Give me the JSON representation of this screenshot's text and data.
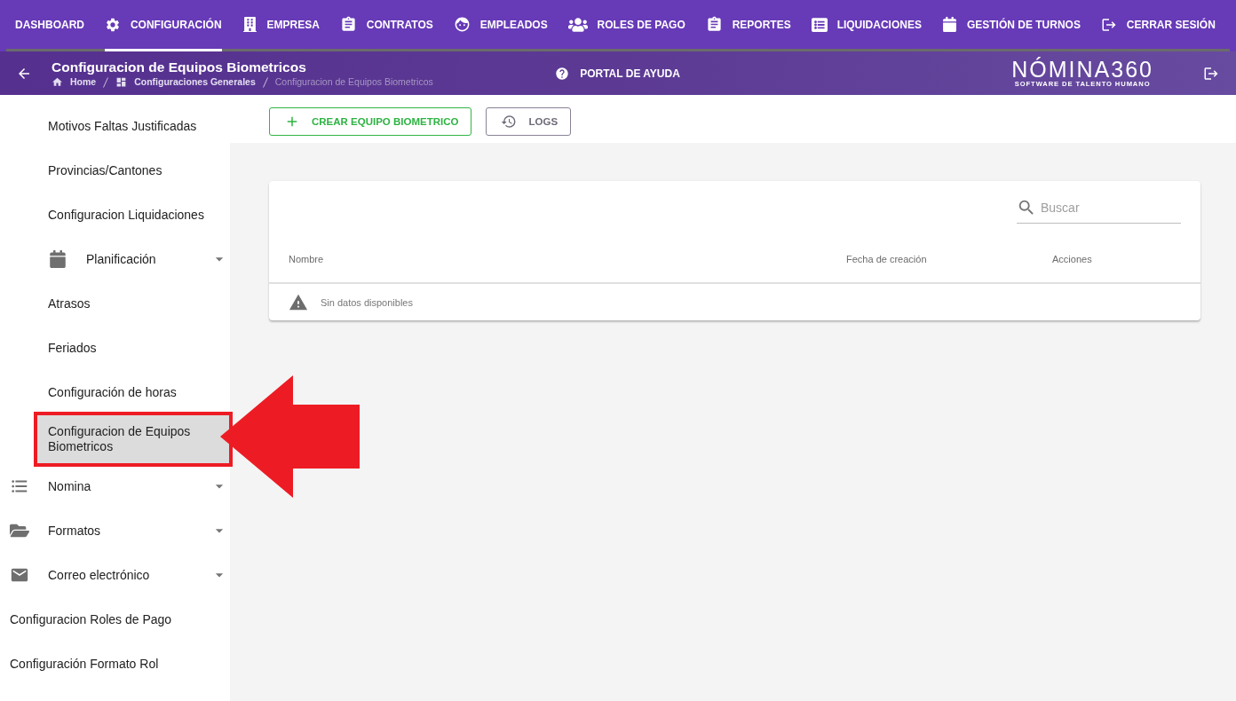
{
  "top_nav": {
    "tabs": [
      {
        "label": "DASHBOARD",
        "selected": false
      },
      {
        "label": "CONFIGURACIÓN",
        "selected": true
      },
      {
        "label": "EMPRESA",
        "selected": false
      },
      {
        "label": "CONTRATOS",
        "selected": false
      },
      {
        "label": "EMPLEADOS",
        "selected": false
      },
      {
        "label": "ROLES DE PAGO",
        "selected": false
      },
      {
        "label": "REPORTES",
        "selected": false
      },
      {
        "label": "LIQUIDACIONES",
        "selected": false
      },
      {
        "label": "GESTIÓN DE TURNOS",
        "selected": false
      },
      {
        "label": "CERRAR SESIÓN",
        "selected": false
      }
    ]
  },
  "header": {
    "title": "Configuracion de Equipos Biometricos",
    "breadcrumbs": [
      {
        "label": "Home",
        "current": false
      },
      {
        "label": "Configuraciones Generales",
        "current": false
      },
      {
        "label": "Configuracion de Equipos Biometricos",
        "current": true
      }
    ],
    "help_link": "PORTAL DE AYUDA",
    "logo": {
      "wordmark": "NÓMINA360",
      "tagline": "SOFTWARE DE TALENTO HUMANO"
    }
  },
  "sidebar": {
    "open_group_items": [
      {
        "label": "Motivos Faltas Justificadas",
        "kind": "link",
        "selected": false,
        "annotated": false
      },
      {
        "label": "Provincias/Cantones",
        "kind": "link",
        "selected": false,
        "annotated": false
      },
      {
        "label": "Configuracion Liquidaciones",
        "kind": "link",
        "selected": false,
        "annotated": false
      },
      {
        "label": "Planificación",
        "kind": "group",
        "expanded": false,
        "selected": false,
        "annotated": false
      },
      {
        "label": "Atrasos",
        "kind": "link",
        "selected": false,
        "annotated": false
      },
      {
        "label": "Feriados",
        "kind": "link",
        "selected": false,
        "annotated": false
      },
      {
        "label": "Configuración de horas",
        "kind": "link",
        "selected": false,
        "annotated": false
      },
      {
        "label": "Configuracion de Equipos Biometricos",
        "kind": "link",
        "selected": true,
        "annotated": true
      }
    ],
    "items": [
      {
        "label": "Nomina",
        "kind": "group",
        "expanded": false,
        "selected": false,
        "annotated": false
      },
      {
        "label": "Formatos",
        "kind": "group",
        "expanded": false,
        "selected": false,
        "annotated": false
      },
      {
        "label": "Correo electrónico",
        "kind": "group",
        "expanded": false,
        "selected": false,
        "annotated": false
      },
      {
        "label": "Configuracion Roles de Pago",
        "kind": "link",
        "selected": false,
        "annotated": false
      },
      {
        "label": "Configuración Formato Rol",
        "kind": "link",
        "selected": false,
        "annotated": false
      }
    ]
  },
  "toolbar": {
    "buttons": [
      {
        "label": "CREAR EQUIPO BIOMETRICO",
        "kind": "create"
      },
      {
        "label": "LOGS",
        "kind": "log"
      }
    ]
  },
  "table": {
    "search": {
      "placeholder": "Buscar"
    },
    "columns": [
      "Nombre",
      "Fecha de creación",
      "Acciones"
    ],
    "empty_message": "Sin datos disponibles"
  }
}
